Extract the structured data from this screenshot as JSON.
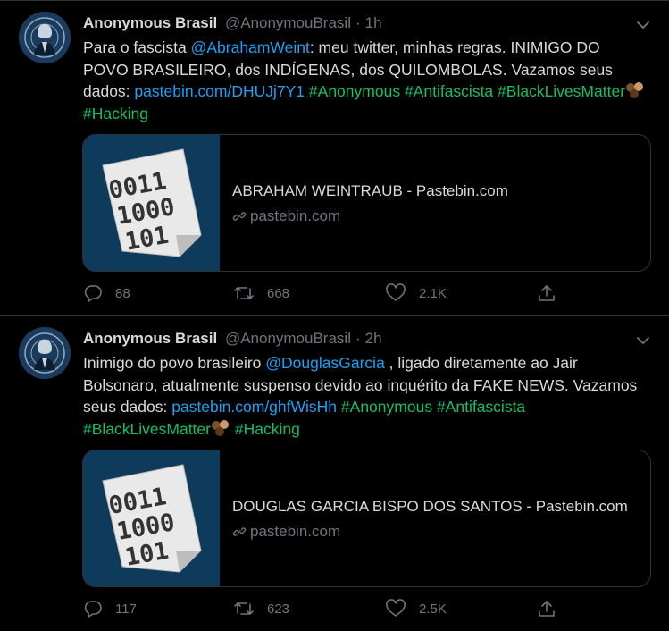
{
  "tweets": [
    {
      "name": "Anonymous Brasil",
      "handle": "@AnonymouBrasil",
      "dot": "·",
      "time": "1h",
      "text": {
        "p1": "Para o fascista ",
        "mention": "@AbrahamWeint",
        "p2": ": meu twitter, minhas regras. INIMIGO DO POVO BRASILEIRO, dos INDÍGENAS, dos QUILOMBOLAS. Vazamos seus dados: ",
        "link": "pastebin.com/DHUJj7Y1",
        "tag1": "#Anonymous",
        "tag2": "#Antifascista",
        "tag3": "#BlackLivesMatter",
        "tag4": "#Hacking"
      },
      "card": {
        "thumb_lines": [
          "0011",
          "1000",
          "101"
        ],
        "title": "ABRAHAM WEINTRAUB - Pastebin.com",
        "domain": "pastebin.com"
      },
      "actions": {
        "replies": "88",
        "retweets": "668",
        "likes": "2.1K"
      }
    },
    {
      "name": "Anonymous Brasil",
      "handle": "@AnonymouBrasil",
      "dot": "·",
      "time": "2h",
      "text": {
        "p1": "Inimigo do povo brasileiro ",
        "mention": "@DouglasGarcia",
        "p2": " , ligado diretamente ao Jair Bolsonaro, atualmente suspenso devido ao inquérito da FAKE NEWS. Vazamos seus dados: ",
        "link": "pastebin.com/ghfWisHh",
        "tag1": "#Anonymous",
        "tag2": "#Antifascista",
        "tag3": "#BlackLivesMatter",
        "tag4": "#Hacking"
      },
      "card": {
        "thumb_lines": [
          "0011",
          "1000",
          "101"
        ],
        "title": "DOUGLAS GARCIA BISPO DOS SANTOS - Pastebin.com",
        "domain": "pastebin.com"
      },
      "actions": {
        "replies": "117",
        "retweets": "623",
        "likes": "2.5K"
      }
    }
  ],
  "colors": {
    "background": "#000000",
    "link": "#1da1f2",
    "hashtag": "#17bf63",
    "muted": "#6e767d",
    "text": "#d9d9d9",
    "border": "#2f3336"
  },
  "icons": [
    "avatar-anonymous-icon",
    "chevron-down-icon",
    "black-fist-emoji-icon",
    "link-icon",
    "reply-icon",
    "retweet-icon",
    "like-icon",
    "share-icon"
  ]
}
